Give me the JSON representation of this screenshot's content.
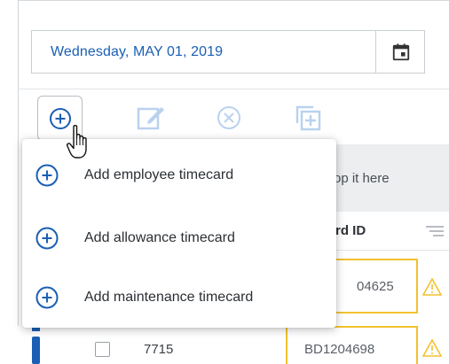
{
  "date_picker": {
    "value": "Wednesday, MAY 01, 2019",
    "calendar_icon": "calendar-icon"
  },
  "toolbar": {
    "tools": [
      {
        "icon": "add-circle-icon",
        "state": "active"
      },
      {
        "icon": "edit-icon",
        "state": "disabled"
      },
      {
        "icon": "remove-circle-icon",
        "state": "disabled"
      },
      {
        "icon": "copy-add-icon",
        "state": "disabled"
      }
    ]
  },
  "add_menu": {
    "items": [
      {
        "icon": "add-circle-icon",
        "label": "Add employee timecard"
      },
      {
        "icon": "add-circle-icon",
        "label": "Add allowance timecard"
      },
      {
        "icon": "add-circle-icon",
        "label": "Add maintenance timecard"
      }
    ]
  },
  "grid": {
    "drop_hint": "op it here",
    "column_header": "rd ID",
    "rows": [
      {
        "number": "",
        "id": "04625"
      },
      {
        "number": "7715",
        "id": "BD1204698"
      }
    ]
  },
  "colors": {
    "accent": "#1a5fb4",
    "warning_border": "#f2c12e",
    "disabled_icon": "#b9d2ee"
  }
}
